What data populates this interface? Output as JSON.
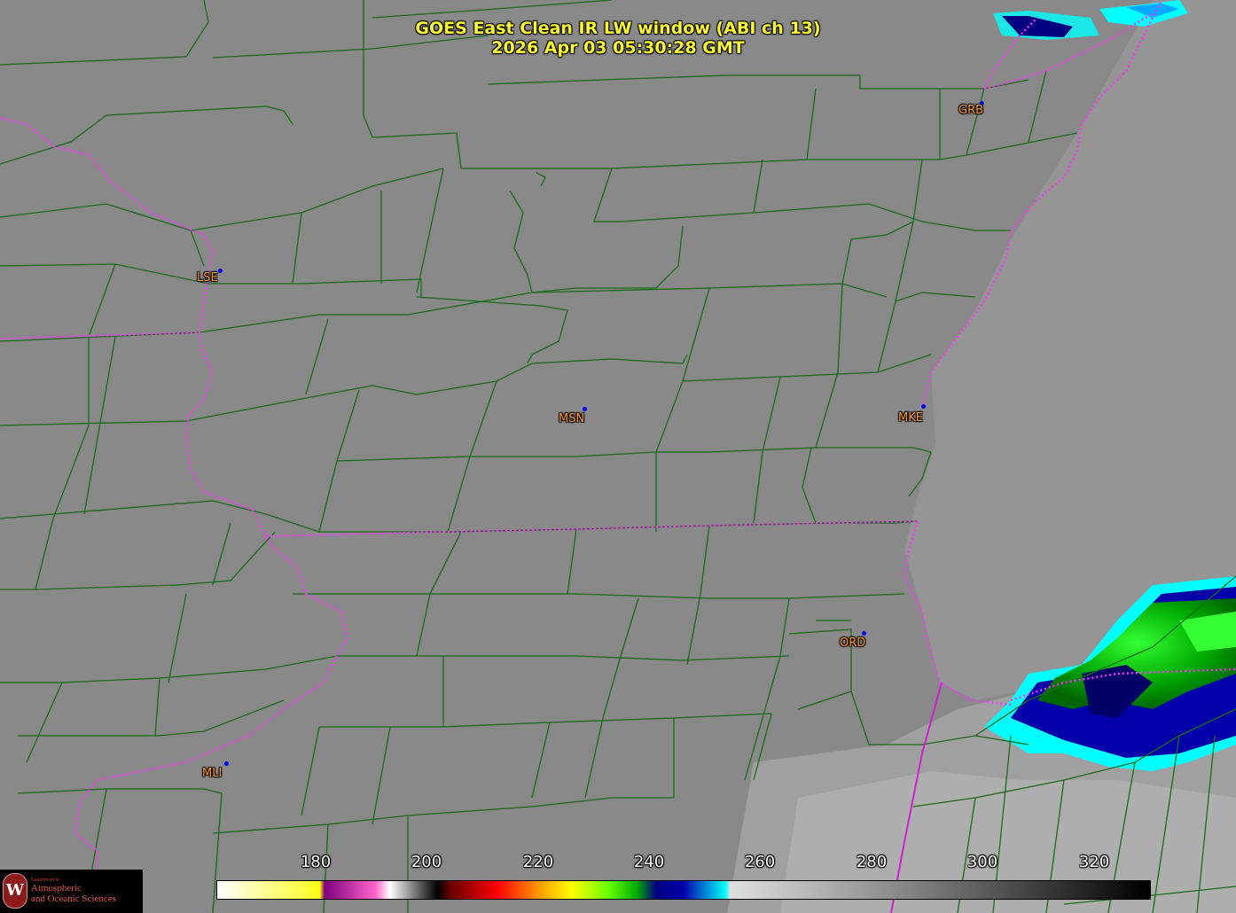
{
  "title": {
    "line1": "GOES East Clean IR LW window (ABI ch 13)",
    "line2": "2026 Apr 03  05:30:28 GMT"
  },
  "cities": [
    {
      "code": "GRB",
      "id": "grb"
    },
    {
      "code": "LSE",
      "id": "lse"
    },
    {
      "code": "MSN",
      "id": "msn"
    },
    {
      "code": "MKE",
      "id": "mke"
    },
    {
      "code": "ORD",
      "id": "ord"
    },
    {
      "code": "MLI",
      "id": "mli"
    }
  ],
  "colorbar": {
    "ticks": [
      "180",
      "200",
      "220",
      "240",
      "260",
      "280",
      "300",
      "320"
    ],
    "range": [
      165,
      333
    ]
  },
  "colors": {
    "county_lines": "#1a6b1a",
    "state_lines": "#ff33ff",
    "city_label": "#ff9933",
    "title": "#ffff33"
  },
  "logo": {
    "line1": "Department of",
    "line2": "Atmospheric",
    "line3": "and Oceanic Sciences",
    "emblem": "W"
  }
}
